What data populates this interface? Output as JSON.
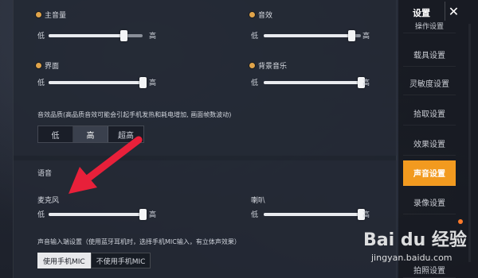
{
  "sound": {
    "master": {
      "label": "主音量",
      "low": "低",
      "high": "高",
      "level": 0.8
    },
    "effects": {
      "label": "音效",
      "low": "低",
      "high": "高",
      "level": 0.9
    },
    "interface": {
      "label": "界面",
      "low": "低",
      "high": "高",
      "level": 1.0
    },
    "bgm": {
      "label": "背景音乐",
      "low": "低",
      "high": "高",
      "level": 1.0
    },
    "quality": {
      "text": "音效品质(高品质音效可能会引起手机发热和耗电增加, 画面帧数波动)",
      "options": [
        "低",
        "高",
        "超高"
      ],
      "selected": "高"
    }
  },
  "voice": {
    "title": "语音",
    "mic": {
      "label": "麦克风",
      "low": "低",
      "high": "高",
      "level": 1.0
    },
    "speaker": {
      "label": "喇叭",
      "low": "低",
      "high": "高",
      "level": 1.0
    },
    "input_text": "声音输入端设置（使用蓝牙耳机时，选择手机MIC输入，有立体声效果）",
    "mic_options": [
      "使用手机MIC",
      "不使用手机MIC"
    ],
    "mic_selected": "使用手机MIC"
  },
  "sidebar": {
    "title": "设置",
    "close_icon": "close-icon",
    "items": [
      "操作设置",
      "载具设置",
      "灵敏度设置",
      "拾取设置",
      "效果设置",
      "声音设置",
      "录像设置",
      "拍照设置"
    ],
    "active": "声音设置"
  },
  "colors": {
    "accent": "#f29a1f",
    "arrow": "#e8203a"
  },
  "watermark": {
    "logo": "Bai du 经验",
    "url": "jingyan.baidu.com"
  }
}
